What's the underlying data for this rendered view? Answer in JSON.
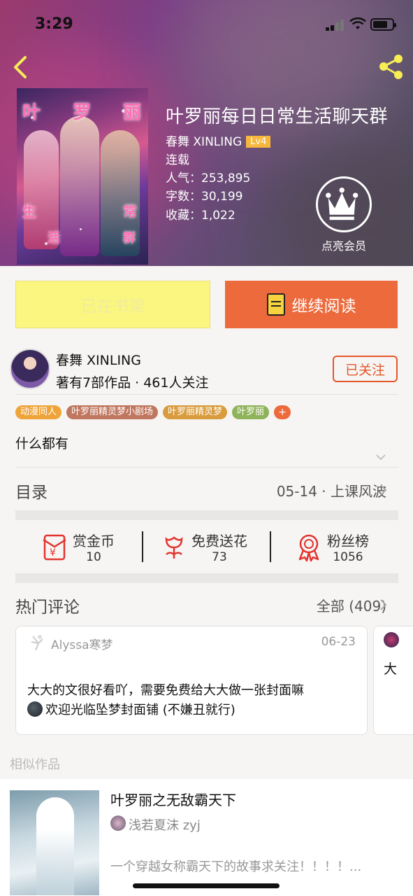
{
  "status_bar": {
    "time": "3:29"
  },
  "book": {
    "title": "叶罗丽每日日常生活聊天群",
    "author_line": "春舞 XINLING",
    "level": "Lv4",
    "status": "连载",
    "popularity": "人气：253,895",
    "word_count": "字数：30,199",
    "favorites": "收藏：1,022",
    "cover_chars": [
      "叶",
      "罗",
      "丽",
      "生",
      "常",
      "活",
      "群"
    ]
  },
  "member": {
    "label": "点亮会员"
  },
  "actions": {
    "shelf_label": "已在书架",
    "read_label": "继续阅读"
  },
  "author": {
    "name": "春舞 XINLING",
    "stats": "著有7部作品 · 461人关注",
    "follow_label": "已关注"
  },
  "tags": [
    {
      "label": "动漫同人",
      "color": "#efa43a"
    },
    {
      "label": "叶罗丽精灵梦小剧场",
      "color": "#c0765f"
    },
    {
      "label": "叶罗丽精灵梦",
      "color": "#d89c3f"
    },
    {
      "label": "叶罗丽",
      "color": "#8fb35a"
    }
  ],
  "tag_add": "+",
  "description": "什么都有",
  "toc": {
    "label": "目录",
    "latest": "05-14 · 上课风波"
  },
  "stats": {
    "coins": {
      "label": "赏金币",
      "value": "10"
    },
    "flowers": {
      "label": "免费送花",
      "value": "73"
    },
    "fans": {
      "label": "粉丝榜",
      "value": "1056"
    }
  },
  "comments": {
    "title": "热门评论",
    "all_label": "全部 (409)",
    "items": [
      {
        "user": "Alyssa寒梦",
        "date": "06-23",
        "line1": "大大的文很好看吖，需要免费给大大做一张封面嘛",
        "line2": "欢迎光临坠梦封面铺 (不嫌丑就行)"
      },
      {
        "text_fragment": "大"
      }
    ]
  },
  "similar": {
    "label": "相似作品",
    "title": "叶罗丽之无敌霸天下",
    "author": "浅若夏沫 zyj",
    "desc": "一个穿越女称霸天下的故事求关注！！！！..."
  },
  "colors": {
    "accent": "#ec6a3c",
    "shelf": "#fbf67f",
    "follow": "#e2572a",
    "icon_yellow": "#f7ee54"
  }
}
